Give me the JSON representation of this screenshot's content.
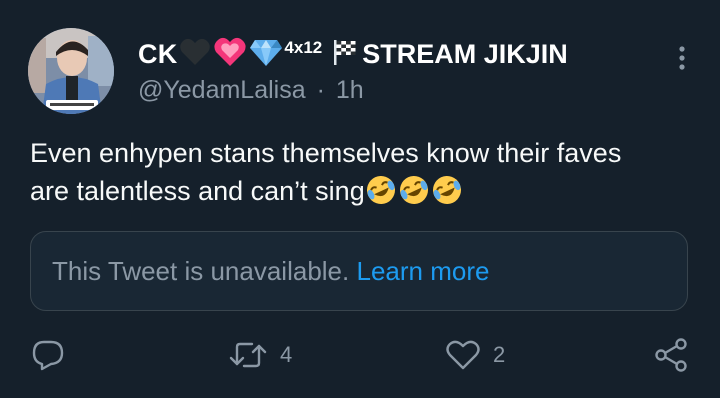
{
  "tweet": {
    "author": {
      "display_name_prefix": "CK",
      "badge_emojis": [
        "black-heart-icon",
        "heart-ribbon-icon",
        "gem-icon"
      ],
      "superscript": "4x12",
      "flag_emoji": "checkered-flag-icon",
      "display_name_suffix": "STREAM JIKJIN",
      "handle": "@YedamLalisa",
      "separator": "·",
      "timestamp": "1h"
    },
    "text_lines": [
      "Even enhypen stans themselves know their faves",
      "are talentless and can’t sing"
    ],
    "trailing_emojis": [
      "rolling-on-floor-laughing-icon",
      "rolling-on-floor-laughing-icon",
      "rolling-on-floor-laughing-icon"
    ],
    "quoted": {
      "unavailable_text": "This Tweet is unavailable.",
      "link_text": "Learn more"
    },
    "actions": {
      "reply_count": "",
      "retweet_count": "4",
      "like_count": "2"
    }
  },
  "colors": {
    "background": "#15202b",
    "text_primary": "#f7f9f9",
    "text_secondary": "#8b98a5",
    "accent": "#1d9bf0",
    "border": "#38444d"
  }
}
